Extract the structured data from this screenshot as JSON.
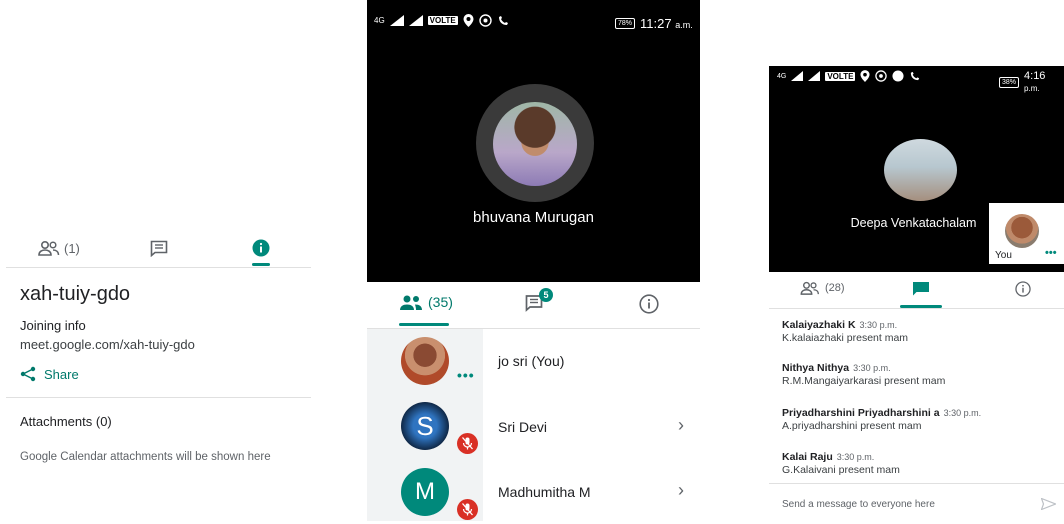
{
  "panel1": {
    "tabs": [
      {
        "icon": "people-icon",
        "label": "(1)"
      },
      {
        "icon": "chat-icon",
        "label": ""
      },
      {
        "icon": "info-icon",
        "label": ""
      }
    ],
    "meeting_code": "xah-tuiy-gdo",
    "joining_heading": "Joining info",
    "joining_url": "meet.google.com/xah-tuiy-gdo",
    "share_label": "Share",
    "attachments_heading": "Attachments (0)",
    "attachments_note": "Google Calendar attachments will be shown here"
  },
  "panel2": {
    "status": {
      "network": "4G",
      "volte": "VOLTE",
      "battery": "78%",
      "time": "11:27",
      "ampm": "a.m."
    },
    "caller_name": "bhuvana Murugan",
    "tabs": {
      "people_count": "(35)",
      "chat_badge": "5"
    },
    "participants": [
      {
        "name": "jo sri (You)",
        "muted": false,
        "avatar_letter": ""
      },
      {
        "name": "Sri Devi",
        "muted": true,
        "avatar_letter": "S"
      },
      {
        "name": "Madhumitha M",
        "muted": true,
        "avatar_letter": "M"
      }
    ],
    "colors": {
      "accent": "#00897b",
      "muted_red": "#d93025",
      "avatar_m": "#00897b"
    }
  },
  "panel3": {
    "status": {
      "network": "4G",
      "volte": "VOLTE",
      "battery": "38%",
      "time": "4:16",
      "ampm": "p.m."
    },
    "speaker_name": "Deepa Venkatachalam",
    "self_label": "You",
    "people_count": "(28)",
    "messages": [
      {
        "sender": "Kalaiyazhaki K",
        "time": "3:30 p.m.",
        "text": "K.kalaiazhaki present mam"
      },
      {
        "sender": "Nithya Nithya",
        "time": "3:30 p.m.",
        "text": "R.M.Mangaiyarkarasi present mam"
      },
      {
        "sender": "Priyadharshini Priyadharshini a",
        "time": "3:30 p.m.",
        "text": "A.priyadharshini present mam"
      },
      {
        "sender": "Kalai Raju",
        "time": "3:30 p.m.",
        "text": "G.Kalaivani present mam"
      }
    ],
    "compose_placeholder": "Send a message to everyone here"
  }
}
